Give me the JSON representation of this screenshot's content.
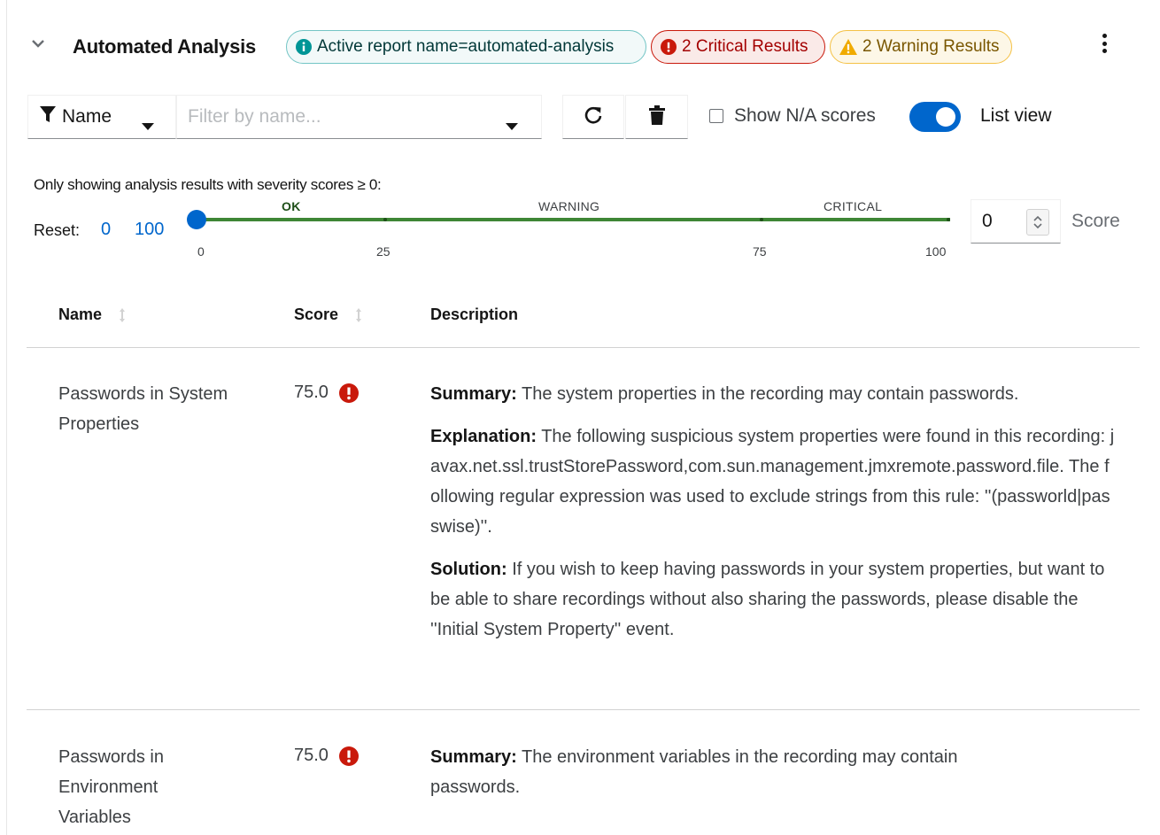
{
  "header": {
    "title": "Automated Analysis",
    "labels": {
      "info": "Active report name=automated-analysis",
      "critical": "2 Critical Results",
      "warning": "2 Warning Results"
    }
  },
  "toolbar": {
    "attribute": "Name",
    "filter_placeholder": "Filter by name...",
    "show_na_label": "Show N/A scores",
    "show_na_checked": false,
    "list_view_label": "List view",
    "list_view_on": true
  },
  "slider": {
    "caption": "Only showing analysis results with severity scores ≥ 0:",
    "reset_label": "Reset:",
    "reset_min": "0",
    "reset_max": "100",
    "zones": {
      "ok": "OK",
      "warning": "WARNING",
      "critical": "CRITICAL"
    },
    "ticks": [
      "0",
      "25",
      "75",
      "100"
    ],
    "value": 0,
    "input_value": "0",
    "unit_label": "Score"
  },
  "table": {
    "headers": {
      "name": "Name",
      "score": "Score",
      "description": "Description"
    },
    "rows": [
      {
        "name": "Passwords in System Properties",
        "score": "75.0",
        "summary_label": "Summary:",
        "summary": "The system properties in the recording may contain passwords.",
        "explanation_label": "Explanation:",
        "explanation": "The following suspicious system properties were found in this recording: javax.net.ssl.trustStorePassword,com.sun.management.jmxremote.password.file. The following regular expression was used to exclude strings from this rule: ''(passworld|passwise)''.",
        "solution_label": "Solution:",
        "solution": "If you wish to keep having passwords in your system properties, but want to be able to share recordings without also sharing the passwords, please disable the ''Initial System Property'' event."
      },
      {
        "name": "Passwords in Environment Variables",
        "score": "75.0",
        "summary_label": "Summary:",
        "summary": "The environment variables in the recording may contain passwords."
      }
    ]
  },
  "colors": {
    "accent": "#0066cc",
    "critical": "#c9190b",
    "warning": "#f0ab00",
    "info": "#009596",
    "ok": "#3e8635"
  }
}
